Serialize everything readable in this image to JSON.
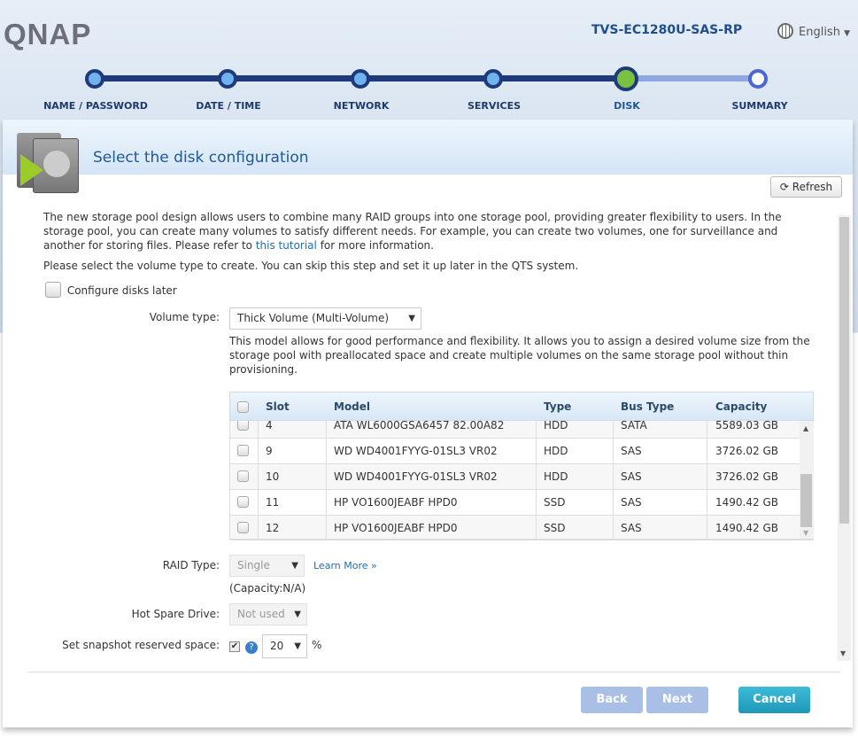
{
  "header": {
    "logo": "QNAP",
    "model": "TVS-EC1280U-SAS-RP",
    "language": "English"
  },
  "steps": [
    {
      "label": "NAME / PASSWORD",
      "state": "done"
    },
    {
      "label": "DATE / TIME",
      "state": "done"
    },
    {
      "label": "NETWORK",
      "state": "done"
    },
    {
      "label": "SERVICES",
      "state": "done"
    },
    {
      "label": "DISK",
      "state": "current"
    },
    {
      "label": "SUMMARY",
      "state": "pending"
    }
  ],
  "panel": {
    "title": "Select the disk configuration",
    "refresh": "Refresh",
    "intro_a": "The new storage pool design allows users to combine many RAID groups into one storage pool, providing greater flexibility to users. In the storage pool, you can create many volumes to satisfy different needs. For example, you can create two volumes, one for surveillance and another for storing files. Please refer to ",
    "intro_link": "this tutorial",
    "intro_b": " for more information.",
    "select_text": "Please select the volume type to create. You can skip this step and set it up later in the QTS system.",
    "configure_later": "Configure disks later",
    "volume_type_label": "Volume type:",
    "volume_type": "Thick Volume (Multi-Volume)",
    "volume_desc": "This model allows for good performance and flexibility. It allows you to assign a desired volume size from the storage pool with preallocated space and create multiple volumes on the same storage pool without thin provisioning.",
    "table": {
      "columns": [
        "Slot",
        "Model",
        "Type",
        "Bus Type",
        "Capacity"
      ],
      "rows": [
        [
          "4",
          "ATA WL6000GSA6457 82.00A82",
          "HDD",
          "SATA",
          "5589.03 GB"
        ],
        [
          "9",
          "WD WD4001FYYG-01SL3 VR02",
          "HDD",
          "SAS",
          "3726.02 GB"
        ],
        [
          "10",
          "WD WD4001FYYG-01SL3 VR02",
          "HDD",
          "SAS",
          "3726.02 GB"
        ],
        [
          "11",
          "HP VO1600JEABF HPD0",
          "SSD",
          "SAS",
          "1490.42 GB"
        ],
        [
          "12",
          "HP VO1600JEABF HPD0",
          "SSD",
          "SAS",
          "1490.42 GB"
        ]
      ]
    },
    "raid_label": "RAID Type:",
    "raid_value": "Single",
    "learn_more": "Learn More »",
    "capacity": "(Capacity:N/A)",
    "spare_label": "Hot Spare Drive:",
    "spare_value": "Not used",
    "snapshot_label": "Set snapshot reserved space:",
    "snapshot_value": "20",
    "snapshot_unit": "%"
  },
  "footer": {
    "back": "Back",
    "next": "Next",
    "cancel": "Cancel"
  },
  "colors": {
    "accent": "#1e3a7a",
    "current_step": "#7ac142",
    "cancel": "#2aa8c4",
    "disabled_btn": "#a9bfe6"
  }
}
